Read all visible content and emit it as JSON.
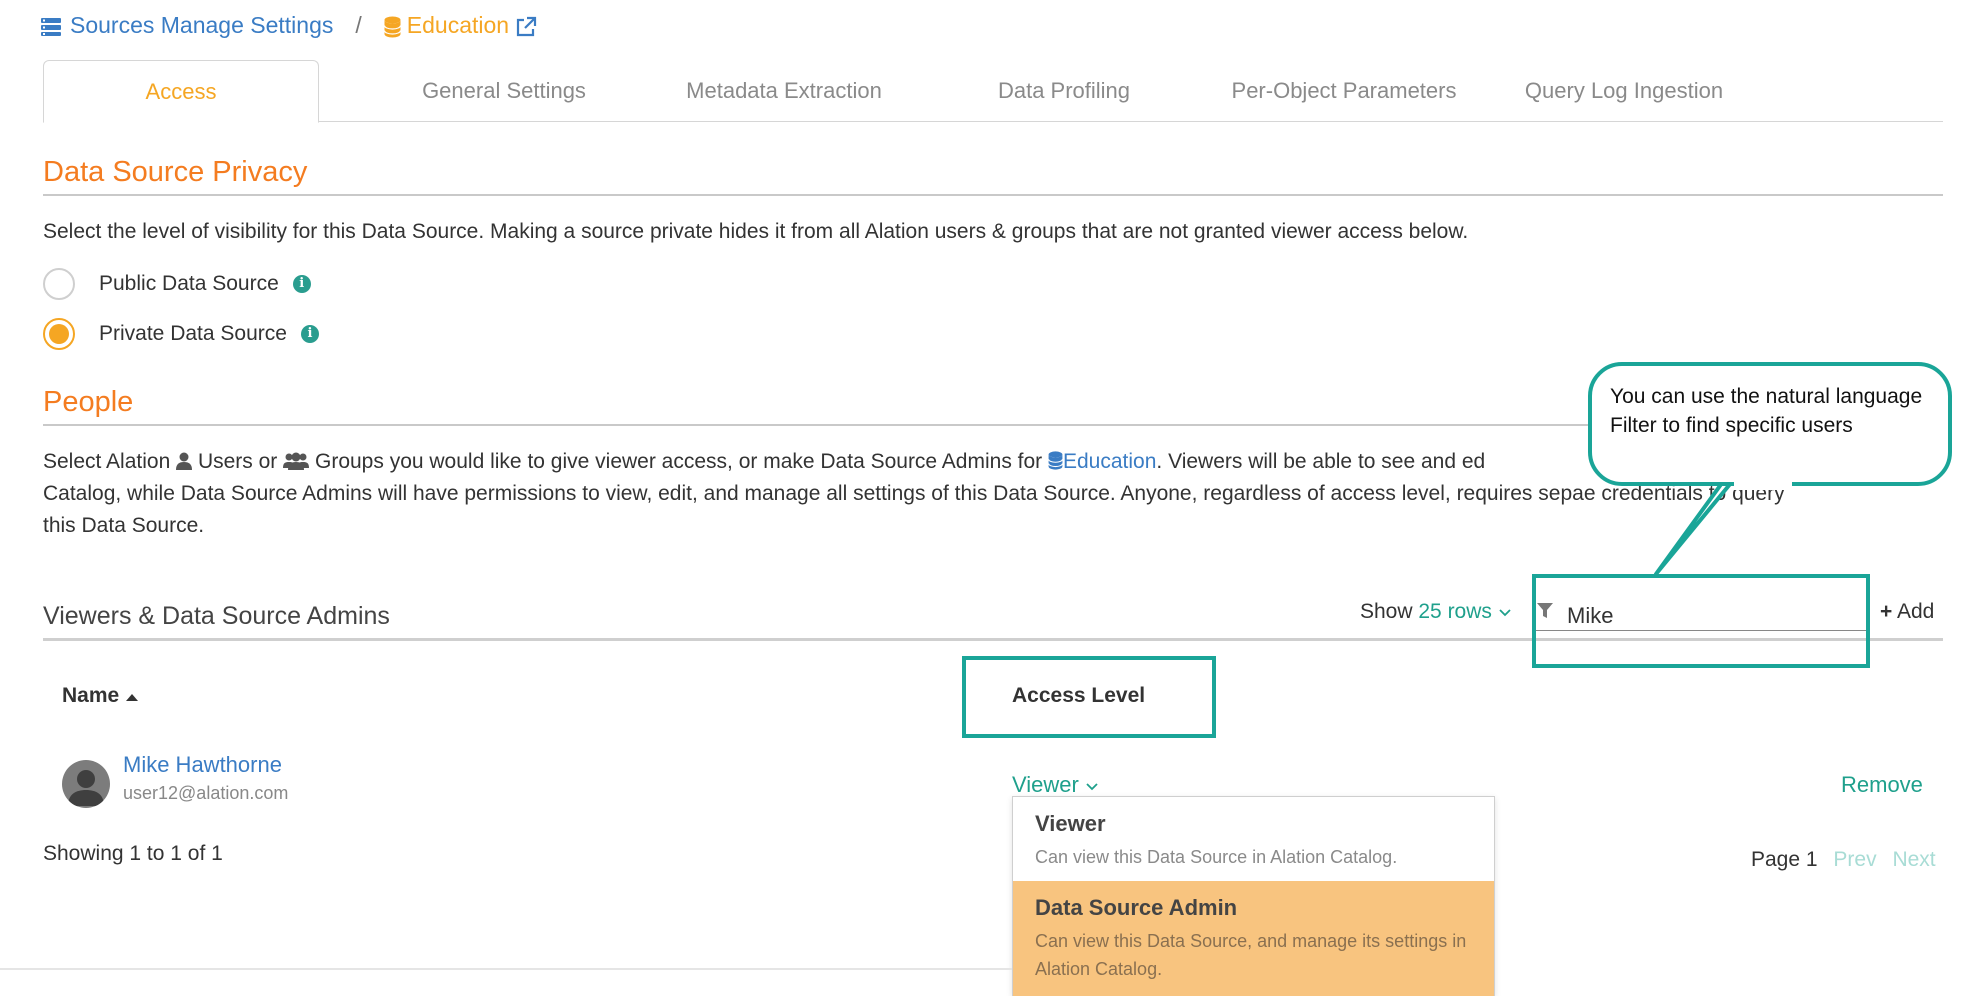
{
  "breadcrumb": {
    "parent": "Sources Manage Settings",
    "separator": "/",
    "current": "Education"
  },
  "tabs": [
    {
      "label": "Access",
      "active": true
    },
    {
      "label": "General Settings",
      "active": false
    },
    {
      "label": "Metadata Extraction",
      "active": false
    },
    {
      "label": "Data Profiling",
      "active": false
    },
    {
      "label": "Per-Object Parameters",
      "active": false
    },
    {
      "label": "Query Log Ingestion",
      "active": false
    }
  ],
  "privacy": {
    "title": "Data Source Privacy",
    "description": "Select the level of visibility for this Data Source. Making a source private hides it from all Alation users & groups that are not granted viewer access below.",
    "options": [
      {
        "label": "Public Data Source",
        "selected": false
      },
      {
        "label": "Private Data Source",
        "selected": true
      }
    ]
  },
  "people": {
    "title": "People",
    "desc_1": "Select Alation",
    "desc_users": "Users or",
    "desc_groups": "Groups you would like to give viewer access, or make Data Source Admins for",
    "desc_source": "Education",
    "desc_line1_rest": ". Viewers will be able to see and ed",
    "desc_line2": "Catalog, while Data Source Admins will have permissions to view, edit, and manage all settings of this Data Source. Anyone, regardless of access level, requires sepa",
    "desc_line2_rest": "e credentials to query",
    "desc_line3": "this Data Source."
  },
  "viewers": {
    "title": "Viewers & Data Source Admins",
    "show_label": "Show",
    "rows_label": "25 rows",
    "filter_value": "Mike",
    "add_label": "Add",
    "columns": {
      "name": "Name",
      "access": "Access Level"
    },
    "rows": [
      {
        "name": "Mike Hawthorne",
        "email": "user12@alation.com",
        "access": "Viewer",
        "remove": "Remove"
      }
    ],
    "showing": "Showing 1 to 1 of 1",
    "page": "Page 1",
    "prev": "Prev",
    "next": "Next"
  },
  "access_dropdown": [
    {
      "title": "Viewer",
      "desc": "Can view this Data Source in Alation Catalog.",
      "highlighted": false
    },
    {
      "title": "Data Source Admin",
      "desc": "Can view this Data Source, and manage its settings in Alation Catalog.",
      "highlighted": true
    }
  ],
  "callout": {
    "text": "You can use the natural language Filter to find specific users"
  },
  "colors": {
    "accent_orange": "#f47c20",
    "tab_orange": "#f5a623",
    "link_blue": "#3a7cc4",
    "teal": "#1fa08c",
    "annotation_teal": "#1aa598",
    "dropdown_highlight": "#f8c47f"
  },
  "icons": [
    "server-icon",
    "database-icon",
    "external-link-icon",
    "info-icon",
    "user-icon",
    "users-icon",
    "filter-icon",
    "plus-icon",
    "chevron-down-icon",
    "sort-up-icon",
    "avatar-icon"
  ]
}
